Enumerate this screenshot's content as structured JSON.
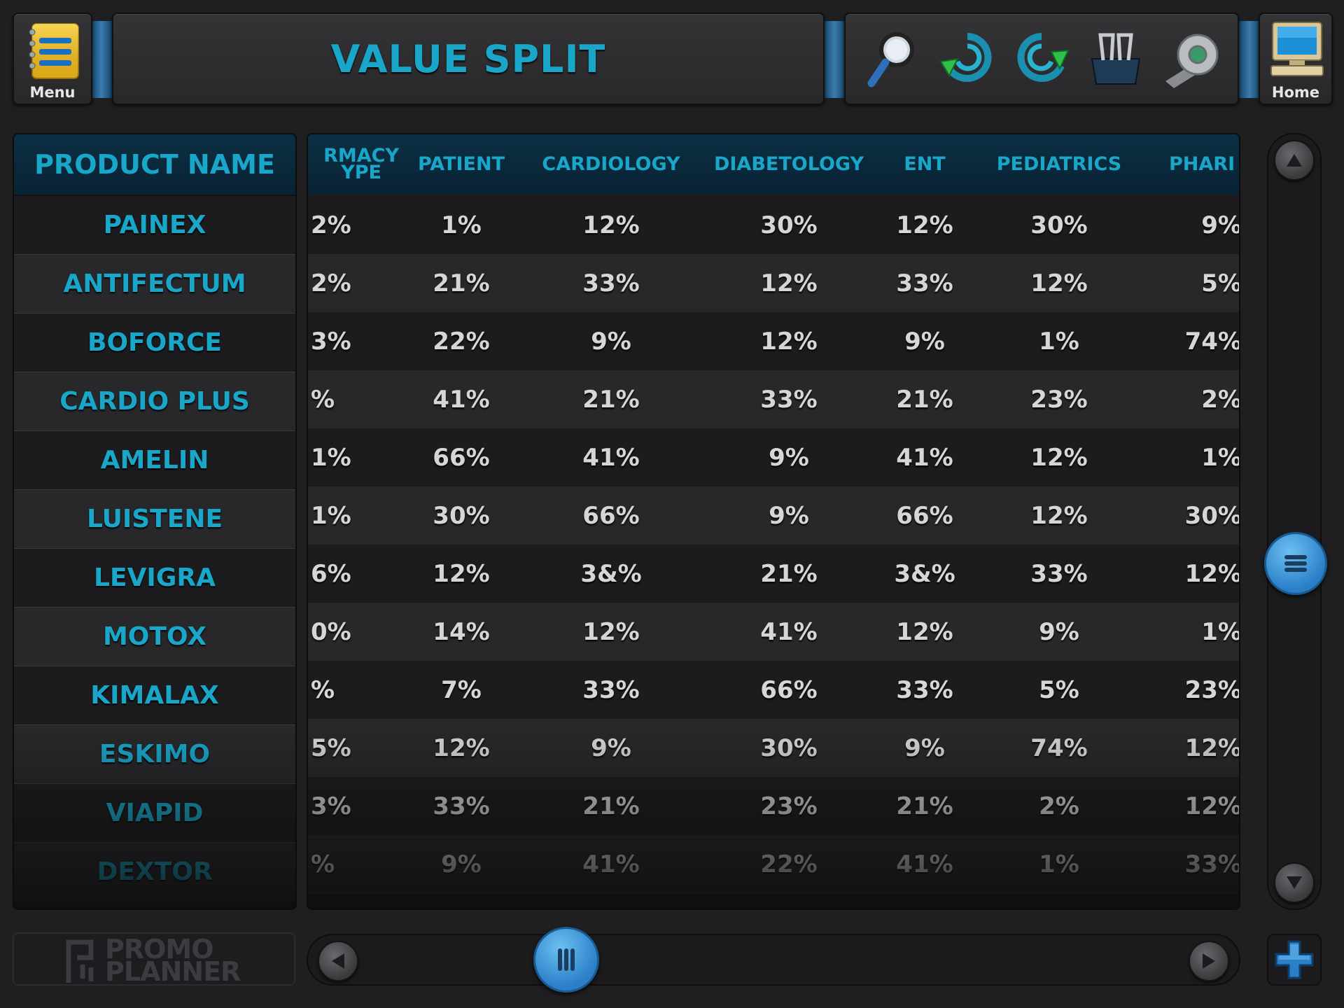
{
  "header": {
    "menu_label": "Menu",
    "home_label": "Home",
    "title": "VALUE SPLIT",
    "tools": [
      "search-icon",
      "undo-icon",
      "redo-icon",
      "binder-clip-icon",
      "tape-icon"
    ]
  },
  "table": {
    "name_header": "PRODUCT NAME",
    "columns": [
      "RMACY\nYPE",
      "PATIENT",
      "CARDIOLOGY",
      "DIABETOLOGY",
      "ENT",
      "PEDIATRICS",
      "PHARI"
    ],
    "rows": [
      {
        "name": "PAINEX",
        "values": [
          "2%",
          "1%",
          "12%",
          "30%",
          "12%",
          "30%",
          "9%"
        ]
      },
      {
        "name": "ANTIFECTUM",
        "values": [
          "2%",
          "21%",
          "33%",
          "12%",
          "33%",
          "12%",
          "5%"
        ]
      },
      {
        "name": "BOFORCE",
        "values": [
          "3%",
          "22%",
          "9%",
          "12%",
          "9%",
          "1%",
          "74%"
        ]
      },
      {
        "name": "CARDIO PLUS",
        "values": [
          "%",
          "41%",
          "21%",
          "33%",
          "21%",
          "23%",
          "2%"
        ]
      },
      {
        "name": "AMELIN",
        "values": [
          "1%",
          "66%",
          "41%",
          "9%",
          "41%",
          "12%",
          "1%"
        ]
      },
      {
        "name": "LUISTENE",
        "values": [
          "1%",
          "30%",
          "66%",
          "9%",
          "66%",
          "12%",
          "30%"
        ]
      },
      {
        "name": "LEVIGRA",
        "values": [
          "6%",
          "12%",
          "3&%",
          "21%",
          "3&%",
          "33%",
          "12%"
        ]
      },
      {
        "name": "MOTOX",
        "values": [
          "0%",
          "14%",
          "12%",
          "41%",
          "12%",
          "9%",
          "1%"
        ]
      },
      {
        "name": "KIMALAX",
        "values": [
          "%",
          "7%",
          "33%",
          "66%",
          "33%",
          "5%",
          "23%"
        ]
      },
      {
        "name": "ESKIMO",
        "values": [
          "5%",
          "12%",
          "9%",
          "30%",
          "9%",
          "74%",
          "12%"
        ]
      },
      {
        "name": "VIAPID",
        "values": [
          "3%",
          "33%",
          "21%",
          "23%",
          "21%",
          "2%",
          "12%"
        ]
      },
      {
        "name": "DEXTOR",
        "values": [
          "%",
          "9%",
          "41%",
          "22%",
          "41%",
          "1%",
          "33%"
        ]
      }
    ]
  },
  "footer": {
    "logo_line1": "PROMO",
    "logo_line2": "PLANNER",
    "add_icon": "plus-icon",
    "horizontal_scroll_position": 0.25,
    "vertical_scroll_position": 0.5
  },
  "colors": {
    "accent": "#1aa6c8",
    "cell_text": "#d6d6d6",
    "background": "#1f1f21",
    "knob": "#2a7fc8"
  }
}
